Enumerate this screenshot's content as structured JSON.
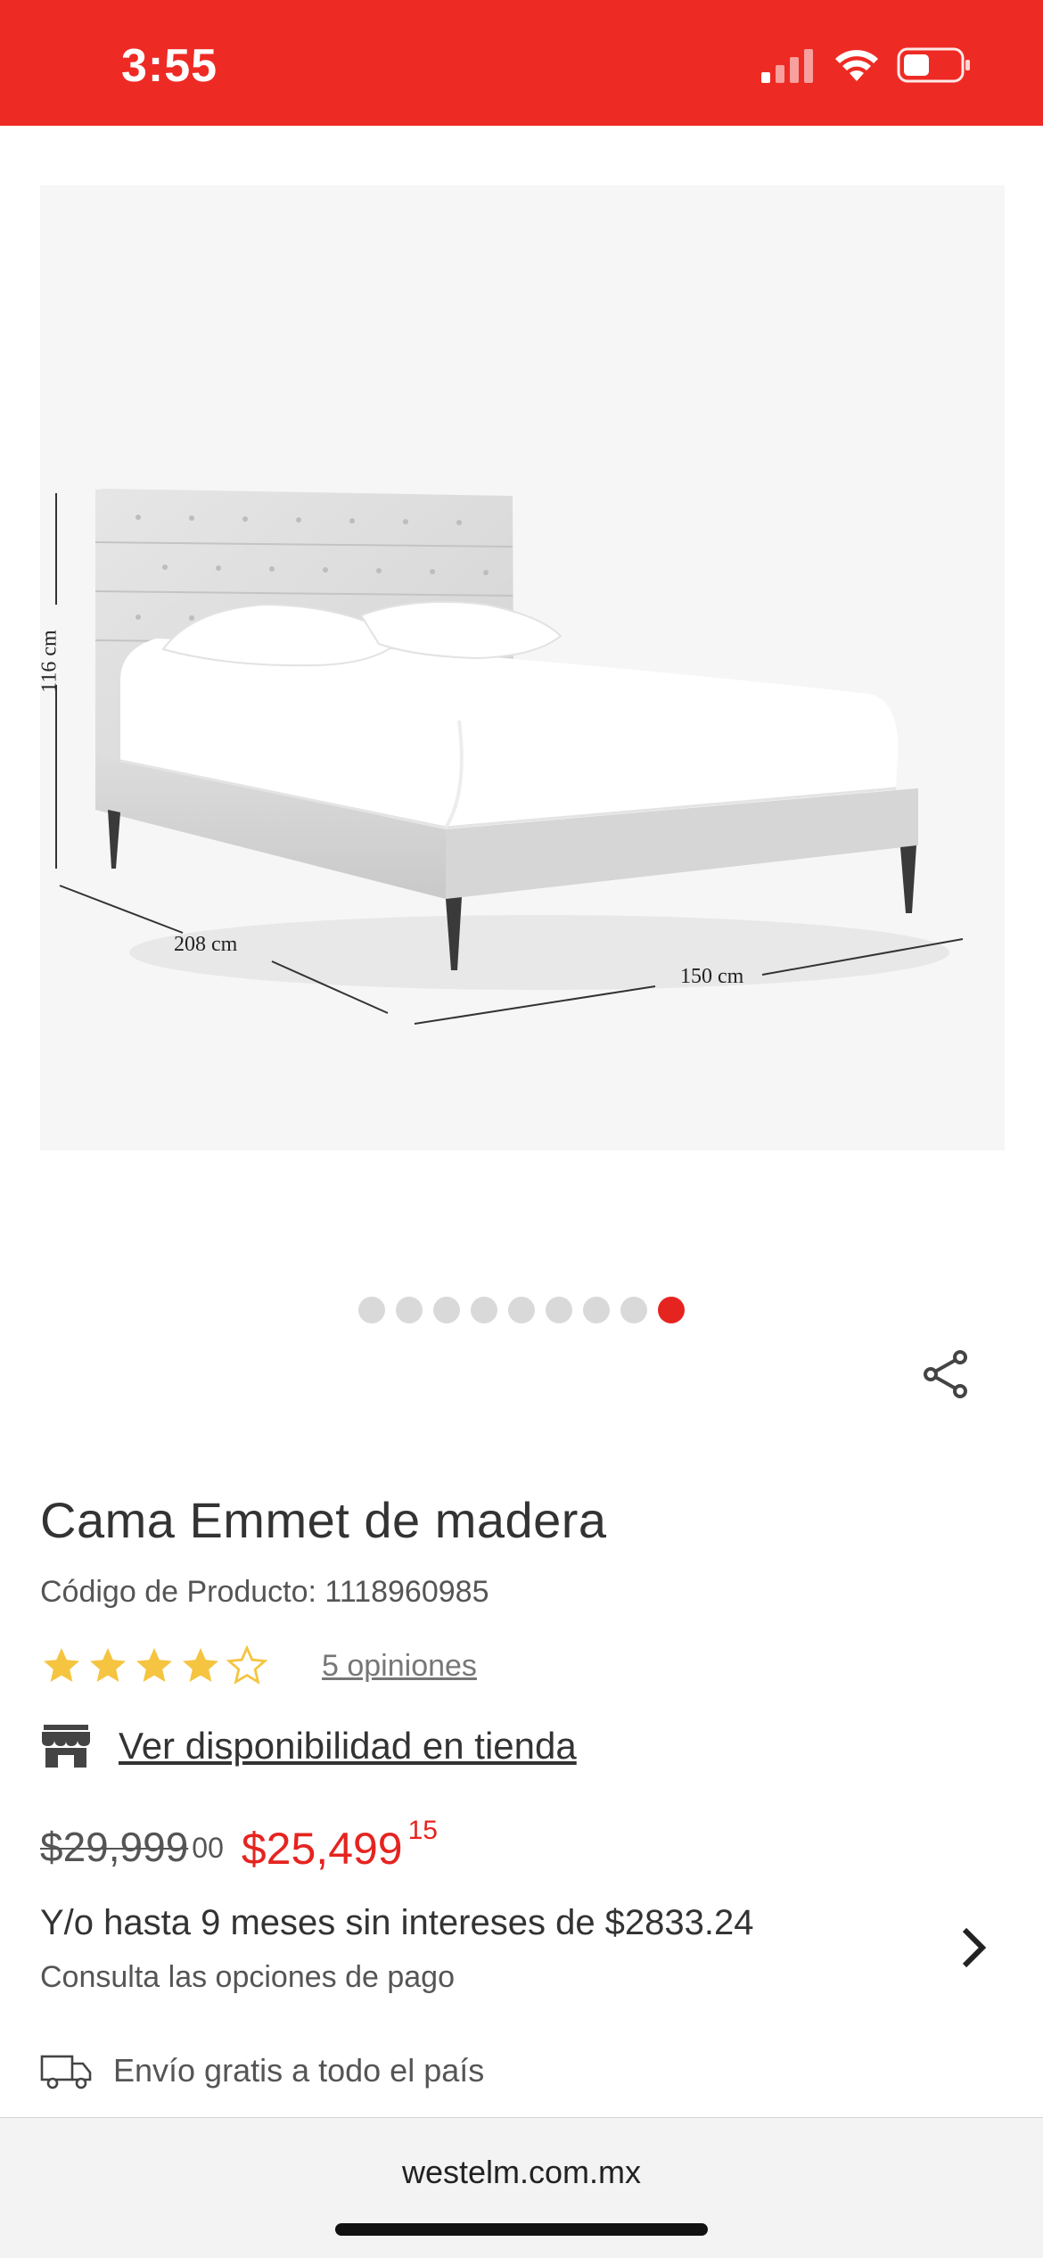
{
  "status_bar": {
    "time": "3:55",
    "background": "#ee2a24"
  },
  "product_image": {
    "dimensions": {
      "height": "116 cm",
      "depth": "208 cm",
      "width": "150 cm"
    }
  },
  "carousel": {
    "total": 9,
    "active_index": 8
  },
  "product": {
    "title": "Cama Emmet de madera",
    "sku_label": "Código de Producto: 1118960985",
    "rating": 4,
    "rating_max": 5,
    "reviews_label": "5 opiniones",
    "store_link": "Ver disponibilidad en tienda"
  },
  "price": {
    "old_whole": "$29,999",
    "old_cents": "00",
    "new_whole": "$25,499",
    "new_cents": "15",
    "accent_color": "#e52420"
  },
  "installments": {
    "title": "Y/o hasta 9 meses sin intereses de $2833.24",
    "subtitle": "Consulta las opciones de pago"
  },
  "shipping": {
    "label": "Envío gratis a todo el país"
  },
  "browser": {
    "url": "westelm.com.mx"
  }
}
